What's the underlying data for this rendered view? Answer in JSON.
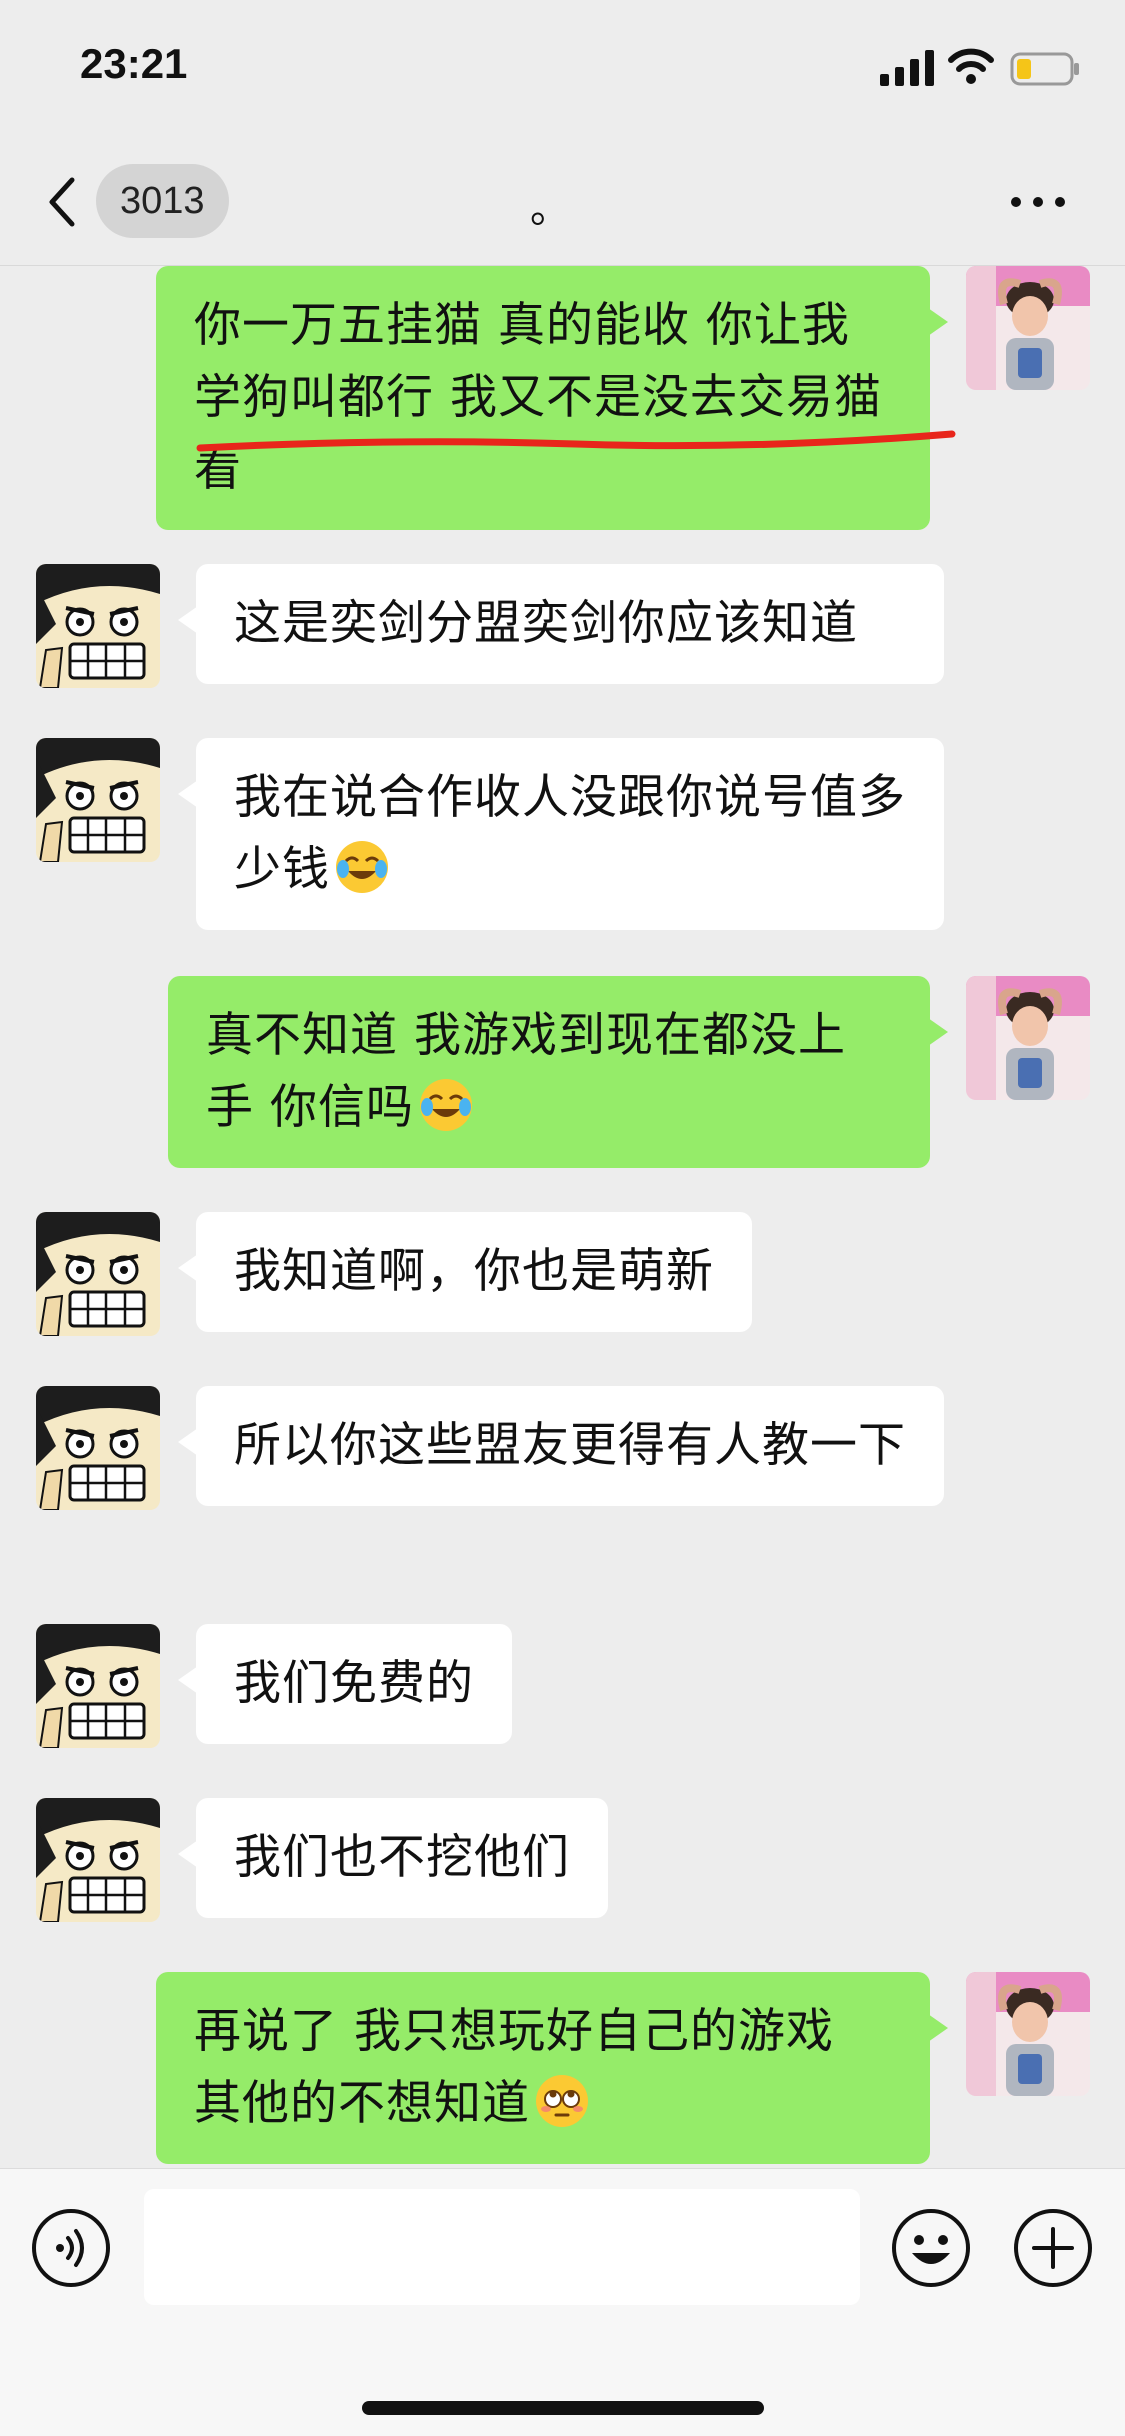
{
  "status_bar": {
    "time": "23:21"
  },
  "header": {
    "unread_count": "3013",
    "title": "。"
  },
  "messages": [
    {
      "side": "out",
      "text": "你一万五挂猫 真的能收 你让我学狗叫都行 我又不是没去交易猫看",
      "emoji": ""
    },
    {
      "side": "in",
      "text": "这是奕剑分盟奕剑你应该知道",
      "emoji": "",
      "underlined": true
    },
    {
      "side": "in",
      "text": "我在说合作收人没跟你说号值多少钱",
      "emoji": "tears-of-joy"
    },
    {
      "side": "out",
      "text": "真不知道 我游戏到现在都没上手 你信吗",
      "emoji": "tears-of-joy"
    },
    {
      "side": "in",
      "text": "我知道啊，你也是萌新",
      "emoji": ""
    },
    {
      "side": "in",
      "text": "所以你这些盟友更得有人教一下",
      "emoji": ""
    },
    {
      "side": "in",
      "text": "我们免费的",
      "emoji": ""
    },
    {
      "side": "in",
      "text": "我们也不挖他们",
      "emoji": ""
    },
    {
      "side": "out",
      "text": "再说了 我只想玩好自己的游戏 其他的不想知道",
      "emoji": "flushed-eye-roll"
    }
  ],
  "colors": {
    "outgoing_bubble": "#95ec69",
    "incoming_bubble": "#ffffff",
    "background": "#ededed",
    "annotation_underline": "#e8251b"
  },
  "input_bar": {
    "placeholder": ""
  }
}
